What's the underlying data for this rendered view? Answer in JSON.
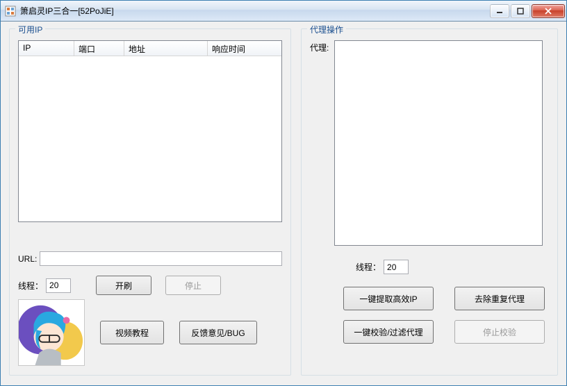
{
  "window": {
    "title": "箫启灵IP三合一[52PoJiE]"
  },
  "left": {
    "legend": "可用IP",
    "columns": {
      "ip": "IP",
      "port": "端口",
      "addr": "地址",
      "resp": "响应时间"
    },
    "url_label": "URL:",
    "url_value": "",
    "thread_label": "线程：",
    "thread_value": "20",
    "start_label": "开刷",
    "stop_label": "停止",
    "video_label": "视频教程",
    "feedback_label": "反馈意见/BUG"
  },
  "right": {
    "legend": "代理操作",
    "proxy_label": "代理:",
    "proxy_value": "",
    "thread_label": "线程：",
    "thread_value": "20",
    "extract_label": "一键提取高效IP",
    "dedupe_label": "去除重复代理",
    "verify_label": "一键校验/过滤代理",
    "stop_verify_label": "停止校验"
  }
}
